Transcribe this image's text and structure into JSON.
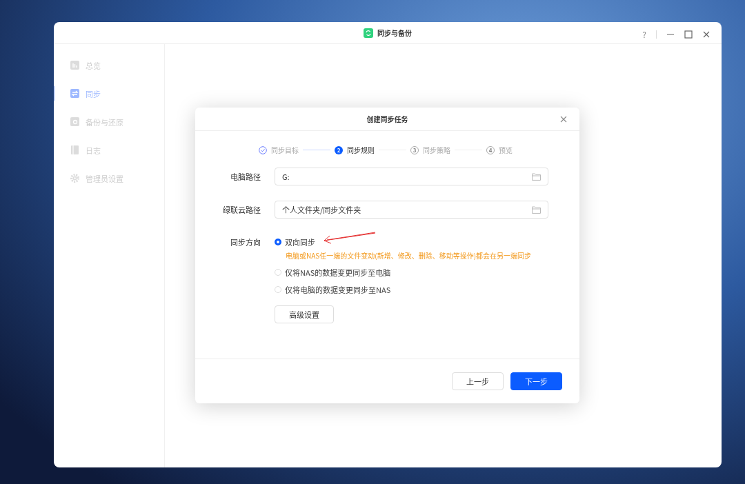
{
  "window": {
    "title": "同步与备份",
    "controls": [
      "?"
    ]
  },
  "sidebar": {
    "items": [
      {
        "label": "总览",
        "selected": false
      },
      {
        "label": "同步",
        "selected": true
      },
      {
        "label": "备份与还原",
        "selected": false
      },
      {
        "label": "日志",
        "selected": false
      },
      {
        "label": "管理员设置",
        "selected": false
      }
    ]
  },
  "dialog": {
    "title": "创建同步任务",
    "steps": [
      {
        "label": "同步目标",
        "kind": "done"
      },
      {
        "number": "2",
        "label": "同步规则",
        "kind": "current"
      },
      {
        "number": "3",
        "label": "同步策略",
        "kind": "pending"
      },
      {
        "number": "4",
        "label": "预览",
        "kind": "pending"
      }
    ],
    "fields": [
      {
        "label": "电脑路径",
        "value": "G:"
      },
      {
        "label": "绿联云路径",
        "value": "个人文件夹/同步文件夹"
      }
    ],
    "direction": {
      "label": "同步方向",
      "options": [
        {
          "label": "双向同步",
          "selected": true,
          "description": "电脑或NAS任一端的文件变动(新增、修改、删除、移动等操作)都会在另一端同步"
        },
        {
          "label": "仅将NAS的数据变更同步至电脑",
          "selected": false
        },
        {
          "label": "仅将电脑的数据变更同步至NAS",
          "selected": false
        }
      ]
    },
    "advanced_button": "高级设置",
    "buttons": [
      {
        "label": "上一步",
        "kind": "secondary"
      },
      {
        "label": "下一步",
        "kind": "primary"
      }
    ]
  }
}
